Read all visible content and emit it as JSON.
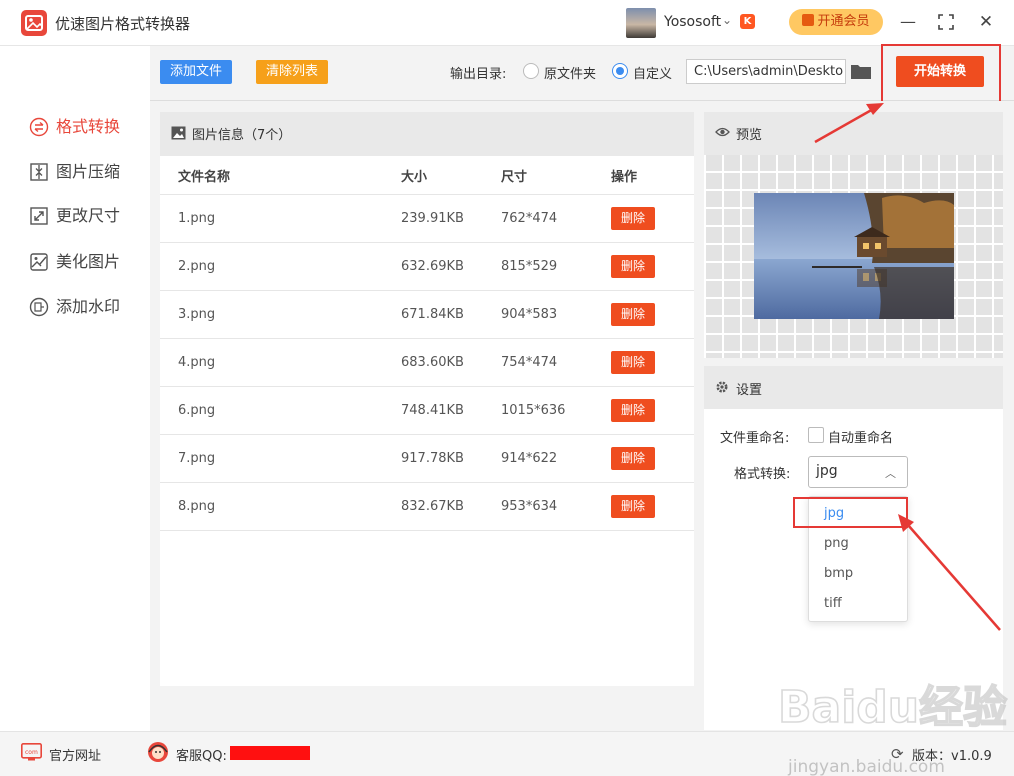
{
  "app": {
    "title": "优速图片格式转换器",
    "user_name": "Yososoft",
    "vip_label": "开通会员"
  },
  "toolbar": {
    "add_file": "添加文件",
    "clear_list": "清除列表",
    "output_label": "输出目录:",
    "radio_original": "原文件夹",
    "radio_custom": "自定义",
    "path_value": "C:\\Users\\admin\\Deskto",
    "start": "开始转换"
  },
  "sidebar": {
    "items": [
      {
        "label": "格式转换",
        "active": true
      },
      {
        "label": "图片压缩",
        "active": false
      },
      {
        "label": "更改尺寸",
        "active": false
      },
      {
        "label": "美化图片",
        "active": false
      },
      {
        "label": "添加水印",
        "active": false
      }
    ]
  },
  "file_list": {
    "title": "图片信息（7个）",
    "columns": [
      "文件名称",
      "大小",
      "尺寸",
      "操作"
    ],
    "delete_label": "删除",
    "rows": [
      {
        "name": "1.png",
        "size": "239.91KB",
        "dim": "762*474"
      },
      {
        "name": "2.png",
        "size": "632.69KB",
        "dim": "815*529"
      },
      {
        "name": "3.png",
        "size": "671.84KB",
        "dim": "904*583"
      },
      {
        "name": "4.png",
        "size": "683.60KB",
        "dim": "754*474"
      },
      {
        "name": "6.png",
        "size": "748.41KB",
        "dim": "1015*636"
      },
      {
        "name": "7.png",
        "size": "917.78KB",
        "dim": "914*622"
      },
      {
        "name": "8.png",
        "size": "832.67KB",
        "dim": "953*634"
      }
    ]
  },
  "preview": {
    "title": "预览"
  },
  "settings": {
    "title": "设置",
    "rename_label": "文件重命名:",
    "rename_option": "自动重命名",
    "format_label": "格式转换:",
    "format_value": "jpg",
    "format_options": [
      "jpg",
      "png",
      "bmp",
      "tiff"
    ]
  },
  "footer": {
    "website": "官方网址",
    "qq_label": "客服QQ:",
    "version": "版本：v1.0.9",
    "watermark_brand": "Baidu经验",
    "watermark_url": "jingyan.baidu.com"
  },
  "colors": {
    "accent_red": "#ef4d1f",
    "accent_blue": "#3b8cf0",
    "accent_orange": "#f6a01a",
    "highlight": "#e53935"
  }
}
